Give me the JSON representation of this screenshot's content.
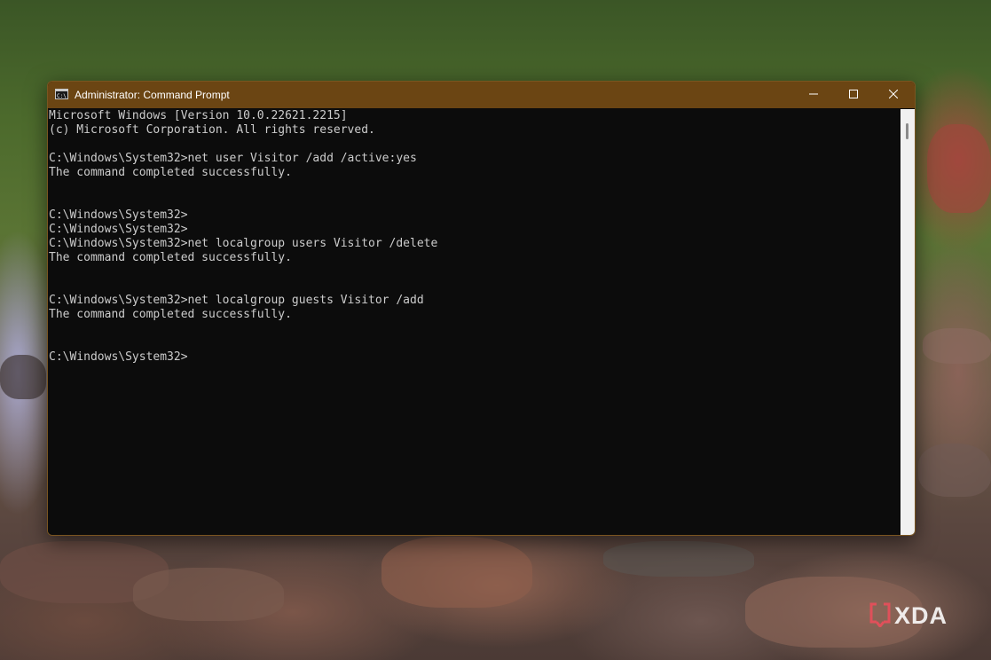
{
  "window": {
    "title": "Administrator: Command Prompt",
    "title_bar_color": "#6b4513",
    "console_bg_color": "#0c0c0c",
    "console_text_color": "#cccccc",
    "app_icon": "cmd-icon",
    "controls": {
      "minimize_icon": "minimize-icon",
      "maximize_icon": "maximize-icon",
      "close_icon": "close-icon"
    }
  },
  "console": {
    "lines": [
      "Microsoft Windows [Version 10.0.22621.2215]",
      "(c) Microsoft Corporation. All rights reserved.",
      "",
      "C:\\Windows\\System32>net user Visitor /add /active:yes",
      "The command completed successfully.",
      "",
      "",
      "C:\\Windows\\System32>",
      "C:\\Windows\\System32>",
      "C:\\Windows\\System32>net localgroup users Visitor /delete",
      "The command completed successfully.",
      "",
      "",
      "C:\\Windows\\System32>net localgroup guests Visitor /add",
      "The command completed successfully.",
      "",
      "",
      "C:\\Windows\\System32>"
    ]
  },
  "watermark": {
    "text": "XDA",
    "icon": "xda-logo-icon"
  }
}
